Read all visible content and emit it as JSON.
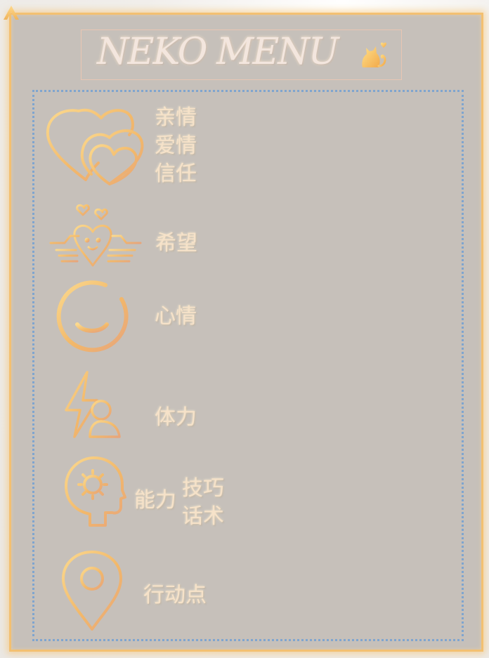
{
  "title": "NEKO MENU",
  "colors": {
    "accent": "#f3c071",
    "card": "#c6c0ba",
    "dots": "#7fa5cf",
    "label": "#f6e2c9"
  },
  "items": [
    {
      "icon": "hearts-icon",
      "lines": [
        "亲情",
        "爱情",
        "信任"
      ]
    },
    {
      "icon": "hands-heart-icon",
      "lines": [
        "希望"
      ]
    },
    {
      "icon": "smiley-icon",
      "lines": [
        "心情"
      ]
    },
    {
      "icon": "lightning-person-icon",
      "lines": [
        "体力"
      ]
    },
    {
      "icon": "head-gear-icon",
      "lines": [
        "能力",
        "技巧",
        "话术"
      ]
    },
    {
      "icon": "location-pin-icon",
      "lines": [
        "行动点"
      ]
    }
  ]
}
